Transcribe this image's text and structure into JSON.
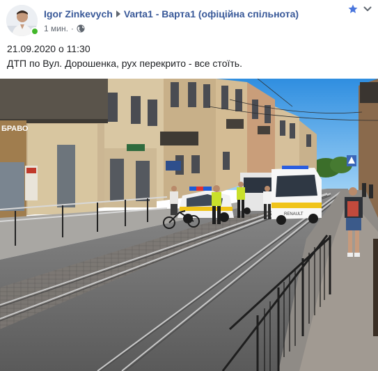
{
  "post": {
    "author": "Igor Zinkevych",
    "group": "Varta1 - Варта1 (офіційна спільнота)",
    "time": "1 мин.",
    "privacy_icon": "globe-icon",
    "status_color": "#42b72a",
    "text_lines": [
      "21.09.2020 о 11:30",
      "ДТП по Вул. Дорошенка, рух перекрито - все стоїть."
    ]
  },
  "photo": {
    "storefront_sign": "БРАВО",
    "vehicle_label": "RENAULT"
  },
  "colors": {
    "link": "#385898",
    "meta": "#606770",
    "star": "#4a76dd"
  }
}
